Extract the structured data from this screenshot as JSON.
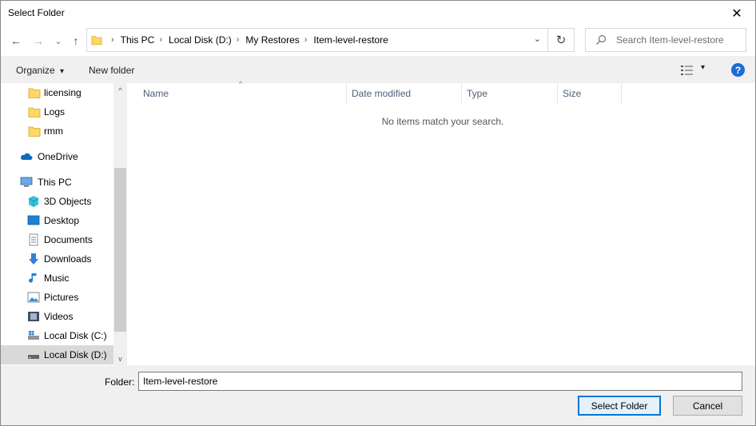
{
  "window": {
    "title": "Select Folder",
    "close_glyph": "✕"
  },
  "nav": {
    "back_glyph": "←",
    "forward_glyph": "→",
    "recent_glyph": "⌄",
    "up_glyph": "↑",
    "breadcrumbs": [
      "This PC",
      "Local Disk (D:)",
      "My Restores",
      "Item-level-restore"
    ],
    "crumb_sep": "›",
    "dropdown_glyph": "⌄",
    "refresh_glyph": "↻",
    "search_placeholder": "Search Item-level-restore"
  },
  "toolbar": {
    "organize_label": "Organize",
    "organize_caret": "▾",
    "new_folder_label": "New folder",
    "view_caret": "▾",
    "help_glyph": "?"
  },
  "sidebar": {
    "items": [
      {
        "label": "licensing",
        "icon": "folder-icon"
      },
      {
        "label": "Logs",
        "icon": "folder-icon"
      },
      {
        "label": "rmm",
        "icon": "folder-icon"
      },
      {
        "label": "OneDrive",
        "icon": "onedrive-icon"
      },
      {
        "label": "This PC",
        "icon": "this-pc-icon"
      },
      {
        "label": "3D Objects",
        "icon": "3d-objects-icon"
      },
      {
        "label": "Desktop",
        "icon": "desktop-icon"
      },
      {
        "label": "Documents",
        "icon": "documents-icon"
      },
      {
        "label": "Downloads",
        "icon": "downloads-icon"
      },
      {
        "label": "Music",
        "icon": "music-icon"
      },
      {
        "label": "Pictures",
        "icon": "pictures-icon"
      },
      {
        "label": "Videos",
        "icon": "videos-icon"
      },
      {
        "label": "Local Disk (C:)",
        "icon": "windows-drive-icon"
      },
      {
        "label": "Local Disk (D:)",
        "icon": "drive-icon",
        "selected": true
      }
    ],
    "scroll_up_glyph": "^",
    "scroll_down_glyph": "v"
  },
  "content": {
    "columns": [
      "Name",
      "Date modified",
      "Type",
      "Size"
    ],
    "sort_caret": "^",
    "empty_message": "No items match your search."
  },
  "footer": {
    "folder_label": "Folder:",
    "folder_value": "Item-level-restore",
    "select_button": "Select Folder",
    "cancel_button": "Cancel"
  },
  "colors": {
    "accent": "#0078d7",
    "help": "#1c6bd6",
    "folder": "#ffd766",
    "selected_row": "#d9d9d9"
  }
}
